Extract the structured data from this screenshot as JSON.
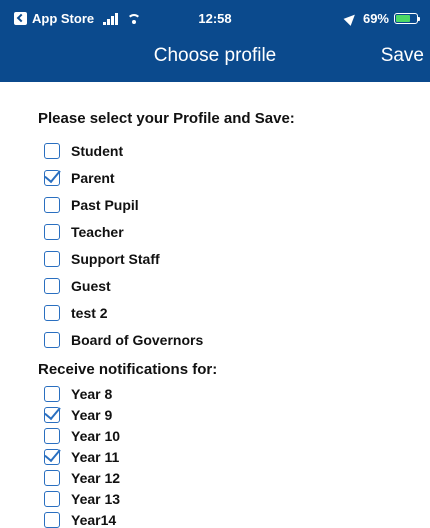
{
  "status_bar": {
    "back_app": "App Store",
    "time": "12:58",
    "battery": "69%",
    "battery_level": 0.69
  },
  "nav": {
    "title": "Choose profile",
    "save_label": "Save"
  },
  "profile_section": {
    "heading": "Please select your Profile and Save:",
    "options": [
      {
        "label": "Student",
        "checked": false
      },
      {
        "label": "Parent",
        "checked": true
      },
      {
        "label": "Past Pupil",
        "checked": false
      },
      {
        "label": "Teacher",
        "checked": false
      },
      {
        "label": "Support Staff",
        "checked": false
      },
      {
        "label": "Guest",
        "checked": false
      },
      {
        "label": "test 2",
        "checked": false
      },
      {
        "label": "Board of Governors",
        "checked": false
      }
    ]
  },
  "notifications_section": {
    "heading": "Receive notifications for:",
    "options": [
      {
        "label": "Year 8",
        "checked": false
      },
      {
        "label": "Year 9",
        "checked": true
      },
      {
        "label": "Year 10",
        "checked": false
      },
      {
        "label": "Year 11",
        "checked": true
      },
      {
        "label": "Year 12",
        "checked": false
      },
      {
        "label": "Year 13",
        "checked": false
      },
      {
        "label": "Year14",
        "checked": false
      }
    ]
  },
  "colors": {
    "header": "#0b4a8d",
    "checkbox": "#2a6fc0",
    "battery": "#4cd964"
  }
}
